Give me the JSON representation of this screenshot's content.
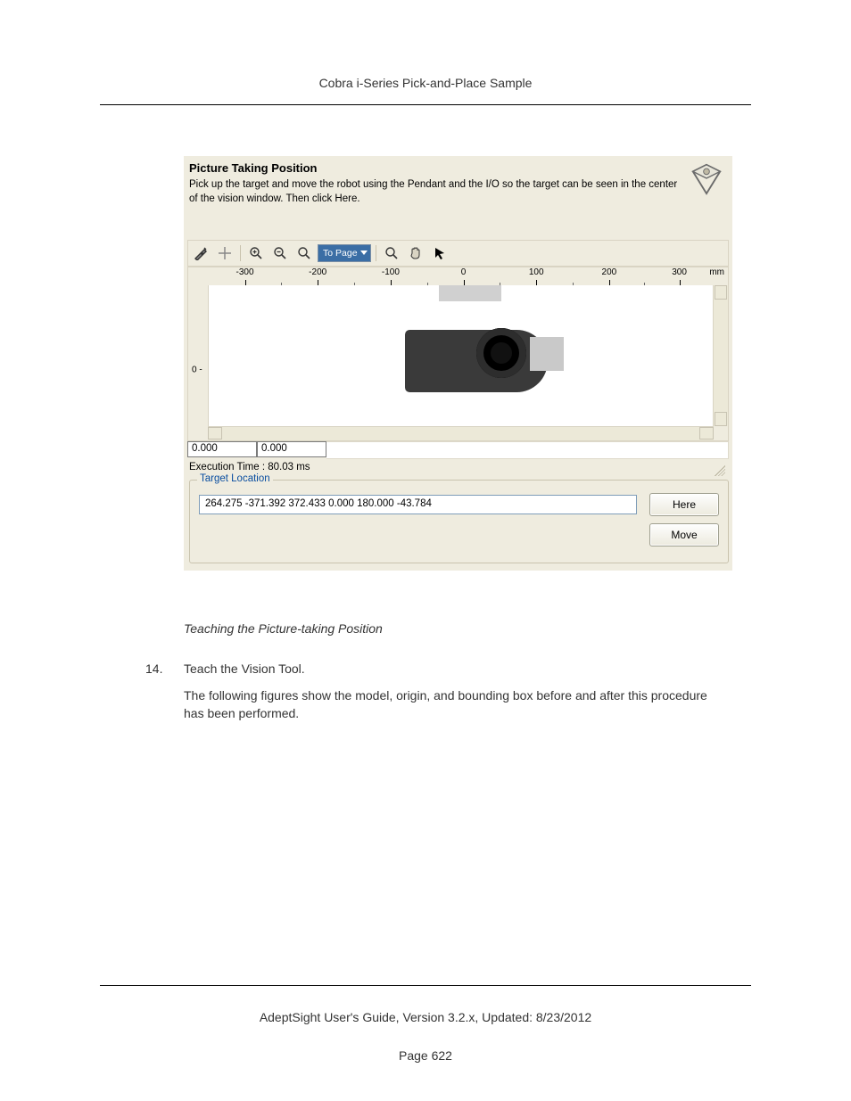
{
  "doc": {
    "header": "Cobra i-Series Pick-and-Place Sample",
    "footer_line": "AdeptSight User's Guide,  Version 3.2.x, Updated: 8/23/2012",
    "page_label": "Page 622"
  },
  "panel": {
    "title": "Picture Taking Position",
    "description": "Pick up the target and move the robot using the Pendant and the I/O so the target can be seen in the center of the vision window.  Then click Here."
  },
  "toolbar": {
    "topage_label": "To Page"
  },
  "ruler": {
    "unit": "mm",
    "ticks": [
      "-300",
      "-200",
      "-100",
      "0",
      "100",
      "200",
      "300"
    ],
    "vmarker": "0 -"
  },
  "coords": {
    "x": "0.000",
    "y": "0.000"
  },
  "exec": {
    "label": "Execution Time :",
    "value": "80.03 ms"
  },
  "target_location": {
    "legend": "Target Location",
    "value": "264.275 -371.392 372.433 0.000 180.000 -43.784",
    "here_label": "Here",
    "move_label": "Move"
  },
  "caption": "Teaching the Picture-taking Position",
  "step": {
    "num": "14.",
    "title": "Teach the Vision Tool.",
    "body": "The following figures show the model, origin, and bounding box before and after this procedure has been performed."
  }
}
